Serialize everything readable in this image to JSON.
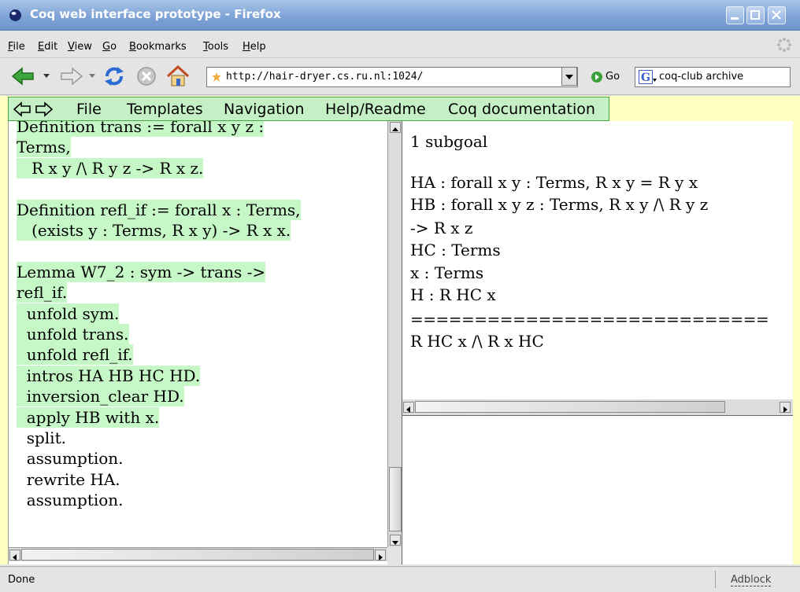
{
  "window": {
    "title": "Coq web interface prototype - Firefox"
  },
  "menubar": {
    "items": [
      "File",
      "Edit",
      "View",
      "Go",
      "Bookmarks",
      "Tools",
      "Help"
    ]
  },
  "navbar": {
    "url": "http://hair-dryer.cs.ru.nl:1024/",
    "go_label": "Go",
    "search_value": "coq-club archive"
  },
  "page_menu": {
    "items": [
      "File",
      "Templates",
      "Navigation",
      "Help/Readme",
      "Coq documentation"
    ]
  },
  "script": {
    "lines": [
      {
        "text": "Definition trans := forall x y z :",
        "processed": true
      },
      {
        "text": "Terms,",
        "processed": true
      },
      {
        "text": "   R x y /\\ R y z -> R x z.",
        "processed": true
      },
      {
        "text": "",
        "processed": false
      },
      {
        "text": "Definition refl_if := forall x : Terms,",
        "processed": true
      },
      {
        "text": "   (exists y : Terms, R x y) -> R x x.",
        "processed": true
      },
      {
        "text": "",
        "processed": false
      },
      {
        "text": "Lemma W7_2 : sym -> trans ->",
        "processed": true
      },
      {
        "text": "refl_if.",
        "processed": true
      },
      {
        "text": "  unfold sym.",
        "processed": true
      },
      {
        "text": "  unfold trans.",
        "processed": true
      },
      {
        "text": "  unfold refl_if.",
        "processed": true
      },
      {
        "text": "  intros HA HB HC HD.",
        "processed": true
      },
      {
        "text": "  inversion_clear HD.",
        "processed": true
      },
      {
        "text": "  apply HB with x.",
        "processed": true
      },
      {
        "text": "  split.",
        "processed": false
      },
      {
        "text": "  assumption.",
        "processed": false
      },
      {
        "text": "  rewrite HA.",
        "processed": false
      },
      {
        "text": "  assumption.",
        "processed": false
      }
    ]
  },
  "goals": {
    "subgoal_count": "1 subgoal",
    "hypotheses": [
      "HA : forall x y : Terms, R x y = R y x",
      "HB : forall x y z : Terms, R x y /\\ R y z",
      "-> R x z",
      "HC : Terms",
      "x : Terms",
      "H : R HC x"
    ],
    "separator": "============================",
    "conclusion": "R HC x /\\ R x HC"
  },
  "statusbar": {
    "status": "Done",
    "adblock": "Adblock"
  },
  "colors": {
    "processed_highlight": "#c6f7c6",
    "page_background": "#ffffc2",
    "titlebar": "#7ea3d6"
  }
}
